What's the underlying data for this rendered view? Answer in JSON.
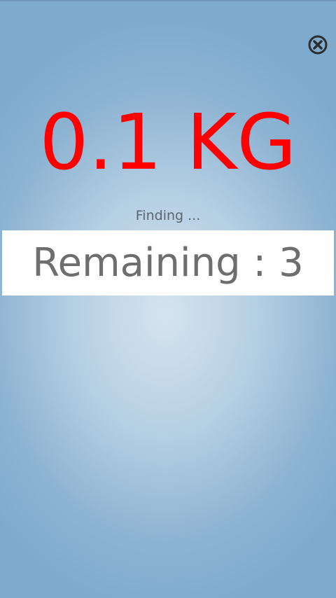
{
  "weight": {
    "value_label": "0.1 KG",
    "color": "#ff0000"
  },
  "status": {
    "text": "Finding ..."
  },
  "remaining": {
    "label": "Remaining : 3"
  },
  "close": {
    "icon": "close-circle-icon"
  },
  "colors": {
    "background_center": "#d6e4ee",
    "background_edge": "#7eaacd",
    "remaining_text": "#6e6e6e",
    "status_text": "#5b6670"
  }
}
